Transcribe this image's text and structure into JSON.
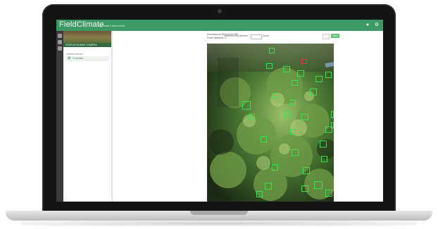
{
  "app": {
    "brand": "FieldClimate",
    "brand_sub": "by Pessl Instruments"
  },
  "sidebar": {
    "station_label": "STATION DUMMY CAMERA",
    "section_label": "Camera device",
    "item_label": "CropView"
  },
  "main": {
    "meta_line1": "Recorded at 2019-04-01 08:",
    "meta_line2": "Pests detected: 0",
    "count_label": "Detected fruit clusters",
    "count_value": "",
    "count_unit": "count",
    "btn_light_label": "",
    "btn_green_label": "Save"
  },
  "icons": {
    "header_1": "user-icon",
    "header_2": "settings-icon"
  },
  "colors": {
    "header": "#3d9a64",
    "detection_box": "#39e24a",
    "detection_alt": "#e03a3a"
  }
}
